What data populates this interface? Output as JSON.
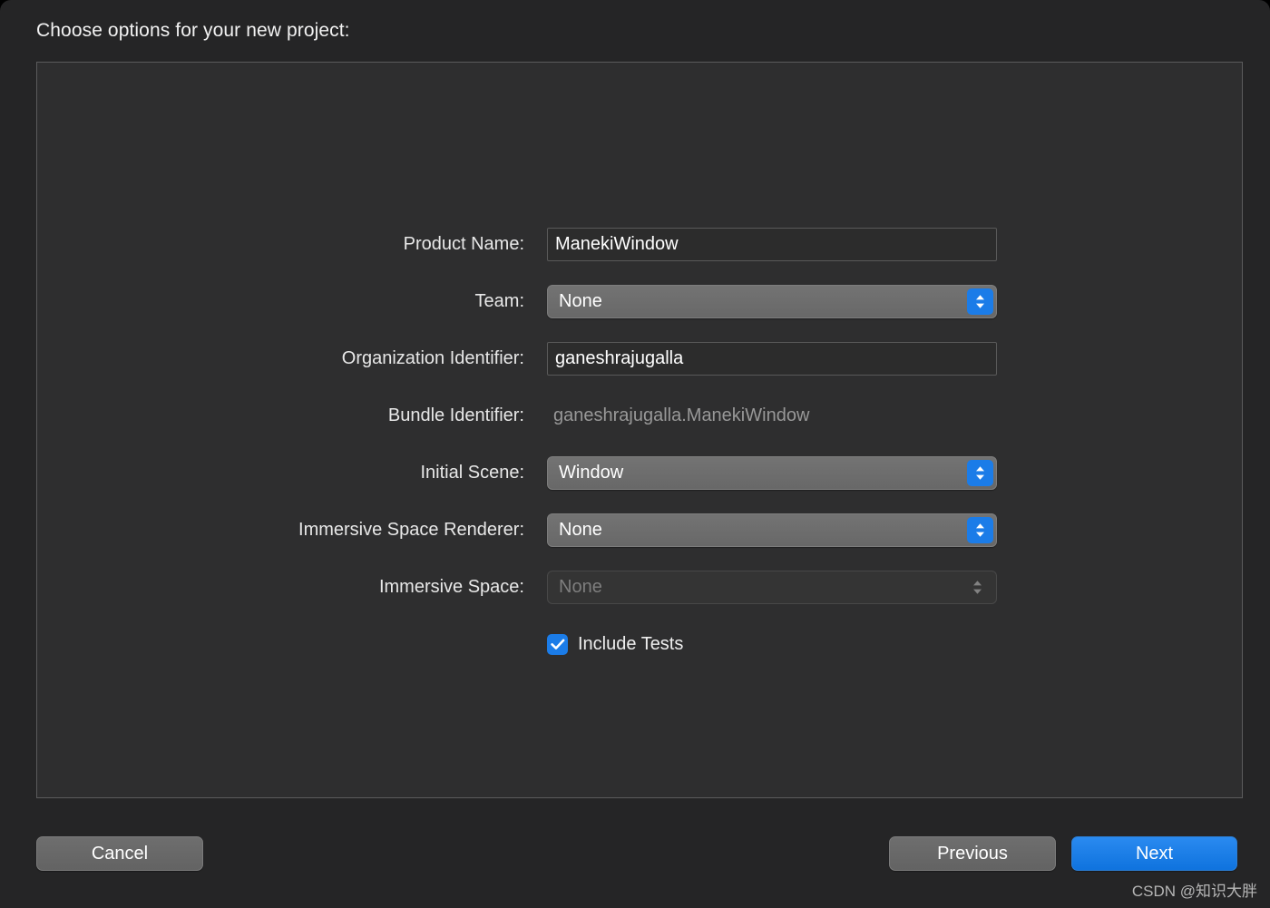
{
  "window": {
    "title": "Choose options for your new project:"
  },
  "form": {
    "rows": [
      {
        "label": "Product Name:",
        "type": "textfield",
        "value": "ManekiWindow",
        "placeholder": ""
      },
      {
        "label": "Team:",
        "type": "popup",
        "value": "None",
        "enabled": true
      },
      {
        "label": "Organization Identifier:",
        "type": "textfield",
        "value": "ganeshrajugalla",
        "placeholder": ""
      },
      {
        "label": "Bundle Identifier:",
        "type": "static",
        "value": "ganeshrajugalla.ManekiWindow"
      },
      {
        "label": "Initial Scene:",
        "type": "popup",
        "value": "Window",
        "enabled": true
      },
      {
        "label": "Immersive Space Renderer:",
        "type": "popup",
        "value": "None",
        "enabled": true
      },
      {
        "label": "Immersive Space:",
        "type": "popup",
        "value": "None",
        "enabled": false
      }
    ],
    "checkbox": {
      "label": "Include Tests",
      "checked": true
    }
  },
  "footer": {
    "cancel_label": "Cancel",
    "previous_label": "Previous",
    "next_label": "Next"
  },
  "watermark": {
    "text": "CSDN @知识大胖"
  },
  "colors": {
    "accent_blue": "#1b7ce8",
    "default_button_blue": "#1a7fe8",
    "window_background": "#252526",
    "panel_background": "#2e2e2f",
    "panel_border": "#5b5b5c",
    "popup_background": "#6b6b6b",
    "textfield_background": "#2c2c2c",
    "label_text": "#e8e8e8",
    "disabled_text": "#7e7e7e",
    "static_text": "#989898"
  }
}
